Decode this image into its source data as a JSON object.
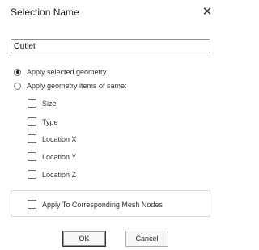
{
  "window": {
    "title": "Selection Name",
    "close_icon": "close-icon"
  },
  "name_field": {
    "value": "Outlet"
  },
  "radios": [
    {
      "label": "Apply selected geometry",
      "checked": true
    },
    {
      "label": "Apply geometry items of same:",
      "checked": false
    }
  ],
  "criteria": [
    {
      "label": "Size",
      "checked": false
    },
    {
      "label": "Type",
      "checked": false
    },
    {
      "label": "Location X",
      "checked": false
    },
    {
      "label": "Location Y",
      "checked": false
    },
    {
      "label": "Location Z",
      "checked": false
    }
  ],
  "mesh_option": {
    "label": "Apply To Corresponding Mesh Nodes",
    "checked": false
  },
  "buttons": {
    "ok": "OK",
    "cancel": "Cancel"
  }
}
